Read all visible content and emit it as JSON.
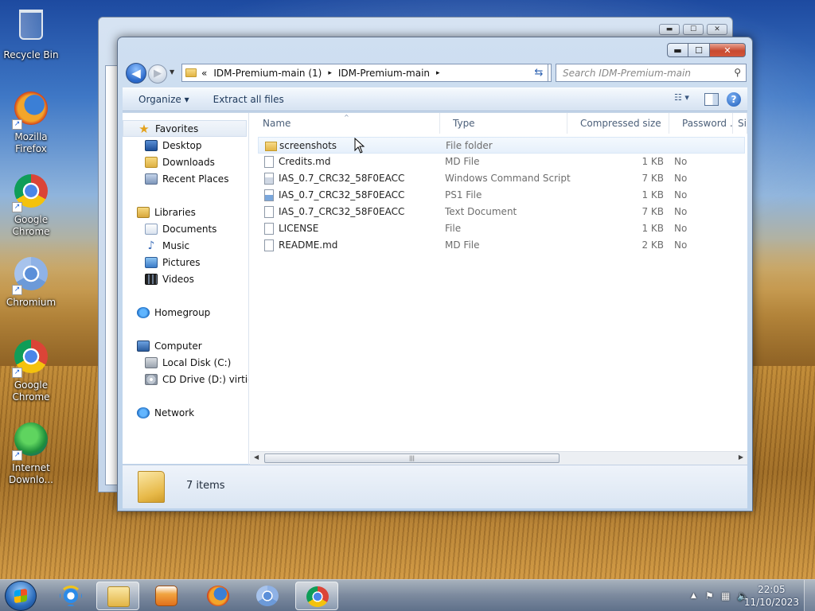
{
  "desktop": {
    "icons": [
      {
        "label": "Recycle Bin",
        "icon": "recycle-bin-icon"
      },
      {
        "label": "Mozilla Firefox",
        "icon": "firefox-icon"
      },
      {
        "label": "Google Chrome",
        "icon": "chrome-icon"
      },
      {
        "label": "Chromium",
        "icon": "chromium-icon"
      },
      {
        "label": "Google Chrome",
        "icon": "chrome-icon"
      },
      {
        "label": "Internet Downlo...",
        "icon": "idm-icon"
      }
    ]
  },
  "window": {
    "controls": {
      "minimize": "▬",
      "maximize": "☐",
      "close": "✕"
    },
    "address": {
      "overflow": "«",
      "crumbs": [
        "IDM-Premium-main (1)",
        "IDM-Premium-main"
      ],
      "separator": "▸"
    },
    "search_placeholder": "Search IDM-Premium-main",
    "toolbar": {
      "organize": "Organize ▾",
      "extract": "Extract all files"
    },
    "nav_pane": {
      "favorites": "Favorites",
      "desktop": "Desktop",
      "downloads": "Downloads",
      "recent": "Recent Places",
      "libraries": "Libraries",
      "documents": "Documents",
      "music": "Music",
      "pictures": "Pictures",
      "videos": "Videos",
      "homegroup": "Homegroup",
      "computer": "Computer",
      "local_disk": "Local Disk (C:)",
      "cd_drive": "CD Drive (D:) virtio-w",
      "network": "Network"
    },
    "columns": [
      "Name",
      "Type",
      "Compressed size",
      "Password ...",
      "Si"
    ],
    "files": [
      {
        "name": "screenshots",
        "type": "File folder",
        "size": "",
        "password": "",
        "icon": "folder-icon"
      },
      {
        "name": "Credits.md",
        "type": "MD File",
        "size": "1 KB",
        "password": "No",
        "icon": "file-icon"
      },
      {
        "name": "IAS_0.7_CRC32_58F0EACC",
        "type": "Windows Command Script",
        "size": "7 KB",
        "password": "No",
        "icon": "script-icon"
      },
      {
        "name": "IAS_0.7_CRC32_58F0EACC",
        "type": "PS1 File",
        "size": "1 KB",
        "password": "No",
        "icon": "powershell-icon"
      },
      {
        "name": "IAS_0.7_CRC32_58F0EACC",
        "type": "Text Document",
        "size": "7 KB",
        "password": "No",
        "icon": "file-icon"
      },
      {
        "name": "LICENSE",
        "type": "File",
        "size": "1 KB",
        "password": "No",
        "icon": "file-icon"
      },
      {
        "name": "README.md",
        "type": "MD File",
        "size": "2 KB",
        "password": "No",
        "icon": "file-icon"
      }
    ],
    "details": {
      "item_count": "7 items"
    }
  },
  "taskbar": {
    "pinned": [
      "internet-explorer-icon",
      "windows-explorer-icon",
      "media-player-icon",
      "firefox-icon",
      "chromium-icon",
      "chrome-icon"
    ],
    "clock": {
      "time": "22:05",
      "date": "11/10/2023"
    }
  }
}
